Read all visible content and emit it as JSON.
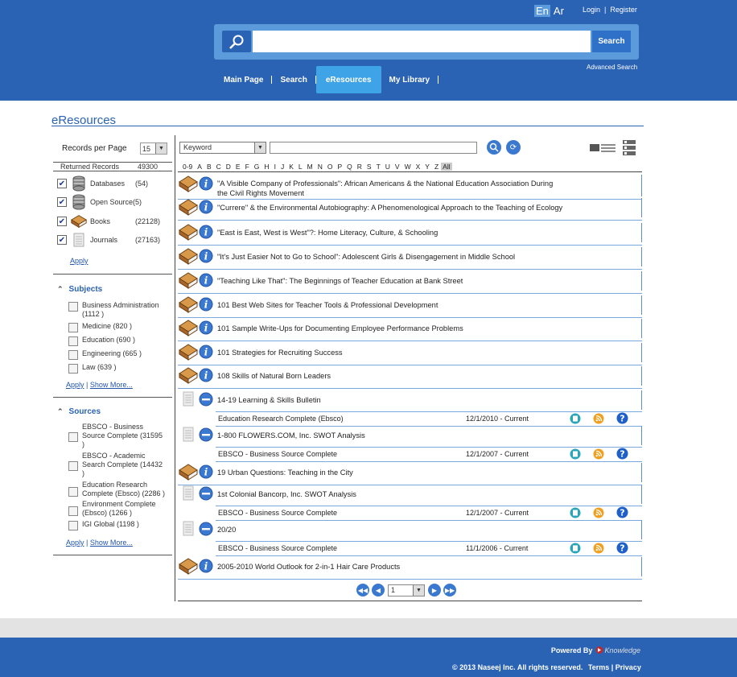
{
  "header": {
    "languages": [
      {
        "label": "En",
        "active": true
      },
      {
        "label": "Ar",
        "active": false
      }
    ],
    "login": "Login",
    "register": "Register",
    "search_button": "Search",
    "advanced_search": "Advanced Search",
    "nav": [
      "Main Page",
      "Search",
      "eResources",
      "My Library"
    ],
    "nav_active": "eResources"
  },
  "page_title": "eResources",
  "sidebar": {
    "records_per_page_label": "Records per Page",
    "records_per_page_value": "15",
    "returned_label": "Returned Records",
    "returned_value": "49300",
    "types": [
      {
        "label": "Databases",
        "count": "(54)",
        "icon": "database-icon"
      },
      {
        "label": "Open Source",
        "count": "(5)",
        "icon": "database-icon"
      },
      {
        "label": "Books",
        "count": "(22128)",
        "icon": "book-icon"
      },
      {
        "label": "Journals",
        "count": "(27163)",
        "icon": "journal-icon"
      }
    ],
    "apply": "Apply",
    "subjects_title": "Subjects",
    "subjects": [
      {
        "l1": "Business Administration",
        "l2": "(1112 )"
      },
      {
        "l1": "Medicine (820 )",
        "l2": ""
      },
      {
        "l1": "Education (690 )",
        "l2": ""
      },
      {
        "l1": "Engineering (665 )",
        "l2": ""
      },
      {
        "l1": "Law (639 )",
        "l2": ""
      }
    ],
    "show_more": "Show More...",
    "sources_title": "Sources",
    "sources": [
      {
        "l1": "EBSCO - Business",
        "l2": "Source Complete (31595",
        "l3": ")"
      },
      {
        "l1": "EBSCO - Academic",
        "l2": "Search Complete (14432",
        "l3": ")"
      },
      {
        "l1": "Education Research",
        "l2": "Complete (Ebsco) (2286 )",
        "l3": ""
      },
      {
        "l1": "Environment Complete",
        "l2": "(Ebsco) (1266 )",
        "l3": ""
      },
      {
        "l1": "IGI Global (1198 )",
        "l2": "",
        "l3": ""
      }
    ]
  },
  "main": {
    "search_type": "Keyword",
    "alphabet": [
      "0-9",
      "A",
      "B",
      "C",
      "D",
      "E",
      "F",
      "G",
      "H",
      "I",
      "J",
      "K",
      "L",
      "M",
      "N",
      "O",
      "P",
      "Q",
      "R",
      "S",
      "T",
      "U",
      "V",
      "W",
      "X",
      "Y",
      "Z",
      "All"
    ],
    "results": [
      {
        "type": "book",
        "title": "\"A Visible Company of Professionals\": African Americans & the National Education Association During",
        "title2": "the Civil Rights Movement"
      },
      {
        "type": "book",
        "title": "\"Currere\" & the Environmental Autobiography: A Phenomenological Approach to the Teaching of Ecology",
        "title2": ""
      },
      {
        "type": "book",
        "title": "\"East is East, West is West\"?: Home Literacy, Culture, & Schooling",
        "title2": ""
      },
      {
        "type": "book",
        "title": "\"It's Just Easier Not to Go to School\": Adolescent Girls & Disengagement in Middle School",
        "title2": ""
      },
      {
        "type": "book",
        "title": "\"Teaching Like That\": The Beginnings of Teacher Education at Bank Street",
        "title2": ""
      },
      {
        "type": "book",
        "title": "101 Best Web Sites for Teacher Tools & Professional Development",
        "title2": ""
      },
      {
        "type": "book",
        "title": "101 Sample Write-Ups for Documenting Employee Performance Problems",
        "title2": ""
      },
      {
        "type": "book",
        "title": "101 Strategies for Recruiting Success",
        "title2": ""
      },
      {
        "type": "book",
        "title": "108 Skills of Natural Born Leaders",
        "title2": ""
      },
      {
        "type": "journal",
        "title": "14-19 Learning & Skills Bulletin",
        "source": "Education Research Complete (Ebsco)",
        "date": "12/1/2010 - Current"
      },
      {
        "type": "journal",
        "title": "1-800 FLOWERS.COM, Inc. SWOT Analysis",
        "source": "EBSCO - Business Source Complete",
        "date": "12/1/2007 - Current"
      },
      {
        "type": "book",
        "title": "19 Urban Questions: Teaching in the City",
        "title2": ""
      },
      {
        "type": "journal",
        "title": "1st Colonial Bancorp, Inc. SWOT Analysis",
        "source": "EBSCO - Business Source Complete",
        "date": "12/1/2007 - Current"
      },
      {
        "type": "journal",
        "title": "20/20",
        "source": "EBSCO - Business Source Complete",
        "date": "11/1/2006 - Current"
      },
      {
        "type": "book",
        "title": "2005-2010 World Outlook for 2-in-1 Hair Care Products",
        "title2": ""
      }
    ],
    "pager_value": "1"
  },
  "footer": {
    "powered_by": "Powered By",
    "brand": "Knowledge",
    "copyright": "© 2013 Naseej Inc. All rights reserved.",
    "terms": "Terms",
    "privacy": "Privacy"
  },
  "colors": {
    "header_blue": "#2a62b4",
    "accent_blue": "#5b9bdc",
    "active_tab": "#3fa3e8"
  }
}
